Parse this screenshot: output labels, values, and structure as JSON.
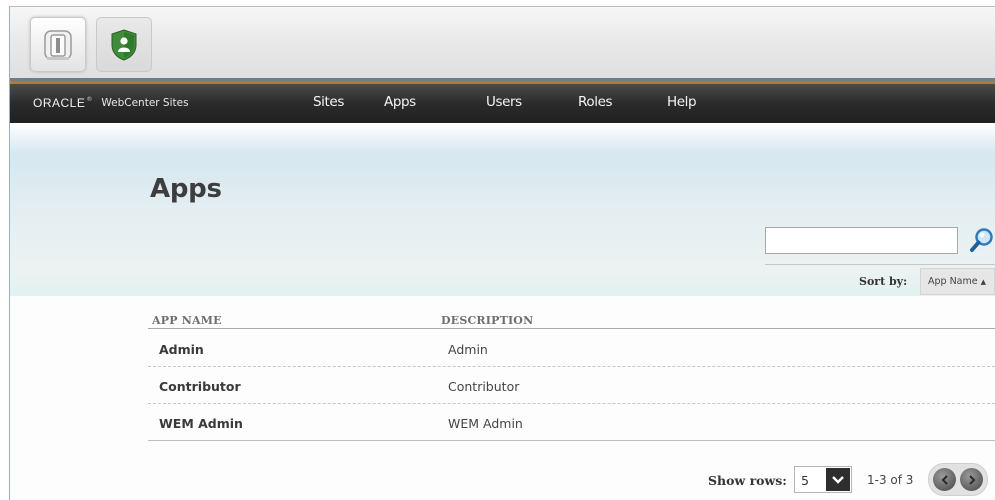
{
  "app_bar": {
    "apps": [
      {
        "name": "admin-app-icon",
        "selected": true
      },
      {
        "name": "wem-app-icon",
        "selected": false
      }
    ]
  },
  "nav": {
    "brand_oracle": "ORACLE",
    "brand_reg": "®",
    "brand_product": "WebCenter Sites",
    "items": [
      "Sites",
      "Apps",
      "Users",
      "Roles",
      "Help"
    ]
  },
  "main": {
    "title": "Apps",
    "search": {
      "value": "",
      "placeholder": ""
    },
    "sort": {
      "label": "Sort by:",
      "value": "App Name",
      "direction_glyph": "▲"
    },
    "table": {
      "headers": [
        "APP NAME",
        "DESCRIPTION"
      ],
      "rows": [
        {
          "name": "Admin",
          "description": "Admin"
        },
        {
          "name": "Contributor",
          "description": "Contributor"
        },
        {
          "name": "WEM Admin",
          "description": "WEM Admin"
        }
      ]
    },
    "pagination": {
      "show_rows_label": "Show rows:",
      "rows_per_page": "5",
      "range": "1-3 of 3"
    }
  },
  "colors": {
    "nav_background": "#2b2b2b",
    "accent_line": "#b77a2d",
    "band_blue": "#d6e7ef"
  }
}
